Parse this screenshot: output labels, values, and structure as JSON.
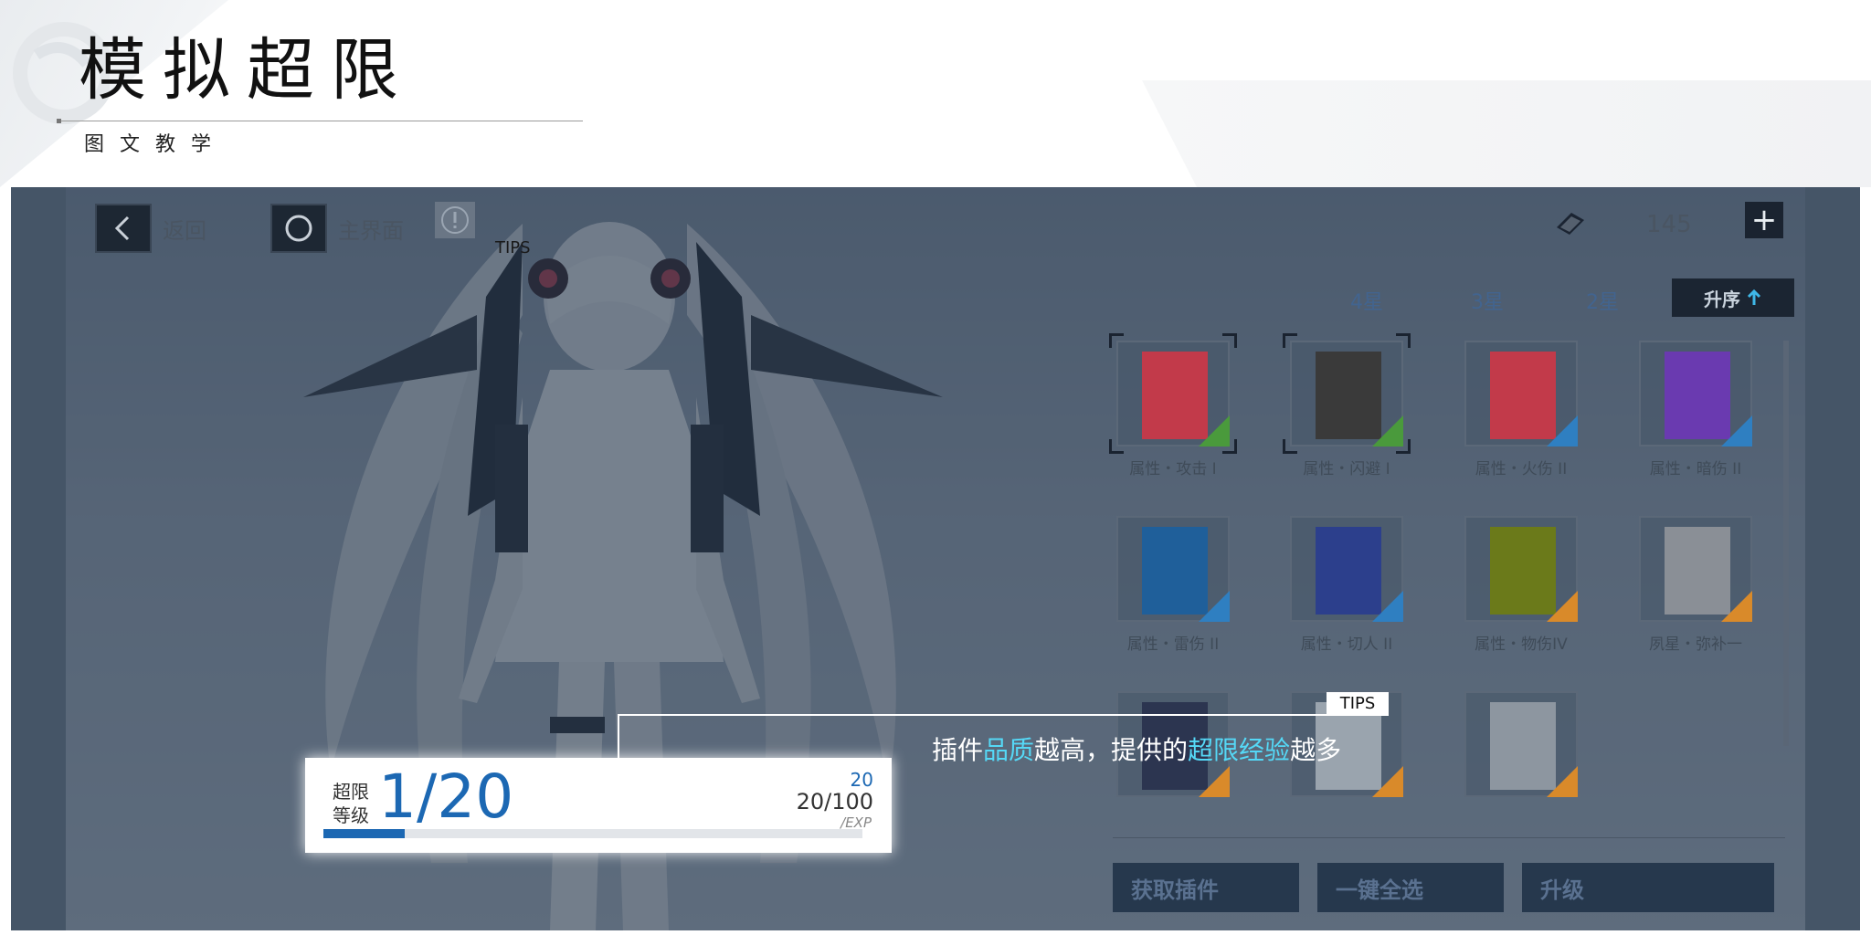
{
  "header": {
    "title": "模拟超限",
    "subtitle": "图文教学"
  },
  "topbar": {
    "back_label": "返回",
    "home_label": "主界面",
    "tips_small": "TIPS",
    "currency_value": "145"
  },
  "filters": {
    "items": [
      "4星",
      "3星",
      "2星"
    ],
    "sort_label": "升序"
  },
  "plugins": [
    {
      "label": "属性・攻击 I",
      "color": "#c23a4a",
      "badge": "#4a9a3c"
    },
    {
      "label": "属性・闪避 I",
      "color": "#3a3a3a",
      "badge": "#4a9a3c"
    },
    {
      "label": "属性・火伤 II",
      "color": "#c23a4a",
      "badge": "#2f7fc1"
    },
    {
      "label": "属性・暗伤 II",
      "color": "#6a3ab0",
      "badge": "#2f7fc1"
    },
    {
      "label": "属性・雷伤 II",
      "color": "#1f5f9a",
      "badge": "#2f7fc1"
    },
    {
      "label": "属性・切人 II",
      "color": "#2c3f8c",
      "badge": "#2f7fc1"
    },
    {
      "label": "属性・物伤IV",
      "color": "#6b7a1a",
      "badge": "#d98a2a"
    },
    {
      "label": "夙星・弥补一",
      "color": "#8a8f96",
      "badge": "#d98a2a"
    },
    {
      "label": "",
      "color": "#2c3550",
      "badge": "#d98a2a"
    },
    {
      "label": "",
      "color": "#9aa4ae",
      "badge": "#d98a2a"
    },
    {
      "label": "",
      "color": "#8d96a0",
      "badge": "#d98a2a"
    }
  ],
  "actions": {
    "get_plugin": "获取插件",
    "select_all": "一键全选",
    "upgrade": "升级"
  },
  "tips": {
    "tag": "TIPS",
    "text_1": "插件",
    "text_hl_1": "品质",
    "text_2": "越高，提供的",
    "text_hl_2": "超限经验",
    "text_3": "越多"
  },
  "level": {
    "label": "超限等级",
    "value": "1/20",
    "max": "20",
    "exp": "20/100",
    "unit": "/EXP",
    "progress_fraction": 0.15
  },
  "colors": {
    "accent_blue": "#1c68b3",
    "highlight_cyan": "#55d8f6",
    "panel_dim": "#1c2c42"
  }
}
